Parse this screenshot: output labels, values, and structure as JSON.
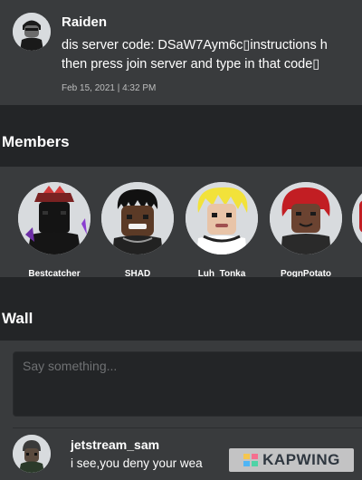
{
  "post": {
    "author": "Raiden",
    "line1": "dis server code: DSaW7Aym6c▯instructions h",
    "line2": "then press join server and type in that code▯",
    "timestamp": "Feb 15, 2021 | 4:32 PM"
  },
  "members": {
    "title": "Members",
    "items": [
      {
        "name": "Bestcatcher"
      },
      {
        "name": "SHAD"
      },
      {
        "name": "Luh_Tonka"
      },
      {
        "name": "PognPotato"
      }
    ]
  },
  "wall": {
    "title": "Wall",
    "placeholder": "Say something...",
    "comment": {
      "author": "jetstream_sam",
      "text": "i see,you deny your wea"
    }
  },
  "watermark": {
    "text": "KAPWING"
  },
  "colors": {
    "background": "#232527",
    "card": "#393b3d",
    "text": "#ffffff",
    "muted": "#bdbebe"
  }
}
